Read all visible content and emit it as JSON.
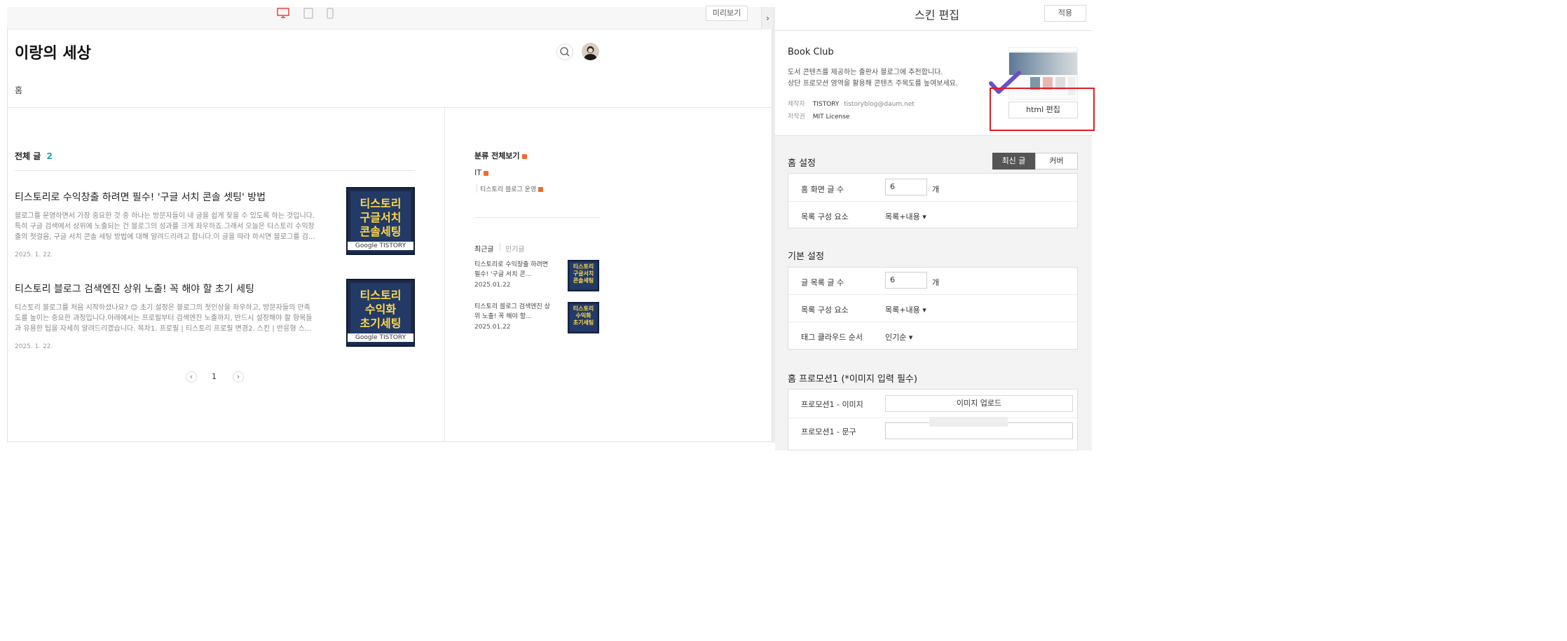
{
  "toolbar": {
    "preview_label": "미리보기",
    "collapse_symbol": "›",
    "devices": [
      {
        "name": "desktop",
        "active": true
      },
      {
        "name": "tablet",
        "active": false
      },
      {
        "name": "mobile",
        "active": false
      }
    ]
  },
  "blog": {
    "title": "이랑의 세상",
    "nav_home": "홈",
    "all_posts_label": "전체 글",
    "all_posts_count": "2",
    "posts": [
      {
        "title": "티스토리로 수익창출 하려면 필수! '구글 서치 콘솔 셋팅' 방법",
        "excerpt_lines": [
          "블로그를 운영하면서 가장 중요한 것 중 하나는 방문자들이 내 글을 쉽게 찾을 수 있도록 하는 것입니다.",
          "특히 구글 검색에서 상위에 노출되는 건 블로그의 성과를 크게 좌우하죠.그래서 오늘은 티스토리 수익창",
          "출의 첫걸음, 구글 서치 콘솔 세팅 방법에 대해 알려드리려고 합니다.이 글을 따라 하시면 블로그를 검..."
        ],
        "date": "2025. 1. 22.",
        "thumb_lines": [
          "티스토리",
          "구글서치",
          "콘솔세팅"
        ],
        "thumb_brand": "Google TISTORY"
      },
      {
        "title": "티스토리 블로그 검색엔진 상위 노출! 꼭 해야 할 초기 세팅",
        "excerpt_lines": [
          "티스토리 블로그를 처음 시작하셨나요? 😊 초기 설정은 블로그의 첫인상을 좌우하고, 방문자들의 만족",
          "도를 높이는 중요한 과정입니다.아래에서는 프로필부터 검색엔진 노출까지, 반드시 설정해야 할 항목들",
          "과 유용한 팁을 자세히 알려드리겠습니다.  목차1. 프로필 | 티스토리 프로필 변경2. 스킨 | 반응형 스..."
        ],
        "date": "2025. 1. 22.",
        "thumb_lines": [
          "티스토리",
          "수익화",
          "초기세팅"
        ],
        "thumb_brand": "Google TISTORY"
      }
    ],
    "pagination": {
      "prev": "‹",
      "current": "1",
      "next": "›"
    },
    "sidebar": {
      "category_all": "분류 전체보기",
      "category_it": "IT",
      "category_sub": "티스토리 블로그 운영",
      "tab_recent": "최근글",
      "tab_popular": "인기글",
      "recent_posts": [
        {
          "title_lines": [
            "티스토리로 수익창출 하려면",
            "필수! '구글 서치 콘..."
          ],
          "date": "2025.01.22"
        },
        {
          "title_lines": [
            "티스토리 블로그 검색엔진 상",
            "위 노출! 꼭 해야 할..."
          ],
          "date": "2025.01.22"
        }
      ]
    }
  },
  "panel": {
    "title": "스킨 편집",
    "apply_label": "적용",
    "skin": {
      "name": "Book Club",
      "desc_lines": [
        "도서 콘텐츠를 제공하는 출판사 블로그에 추천합니다.",
        "상단 프로모션 영역을 활용해 콘텐츠 주목도를 높여보세요."
      ],
      "maker_label": "제작자",
      "maker_value": "TISTORY",
      "maker_email": "tistoryblog@daum.net",
      "license_label": "저작권",
      "license_value": "MIT License",
      "html_edit_label": "html 편집"
    },
    "home_settings": {
      "title": "홈 설정",
      "toggle": [
        "최신 글",
        "커버"
      ],
      "rows": [
        {
          "label": "홈 화면 글 수",
          "value": "6",
          "unit": "개"
        },
        {
          "label": "목록 구성 요소",
          "select": "목록+내용 ▾"
        }
      ]
    },
    "basic_settings": {
      "title": "기본 설정",
      "rows": [
        {
          "label": "글 목록 글 수",
          "value": "6",
          "unit": "개"
        },
        {
          "label": "목록 구성 요소",
          "select": "목록+내용 ▾"
        },
        {
          "label": "태그 클라우드 순서",
          "select": "인기순 ▾"
        }
      ]
    },
    "promo1": {
      "title": "홈 프로모션1 (*이미지 입력 필수)",
      "image_label": "프로모션1 - 이미지",
      "upload_label": "이미지 업로드",
      "text_label": "프로모션1 - 문구"
    }
  },
  "colors": {
    "accent_red": "#e8392f",
    "teal": "#19a5b5",
    "dark_btn": "#555555",
    "highlight_box": "#e31b23",
    "check_purple": "#6a4fc8"
  }
}
